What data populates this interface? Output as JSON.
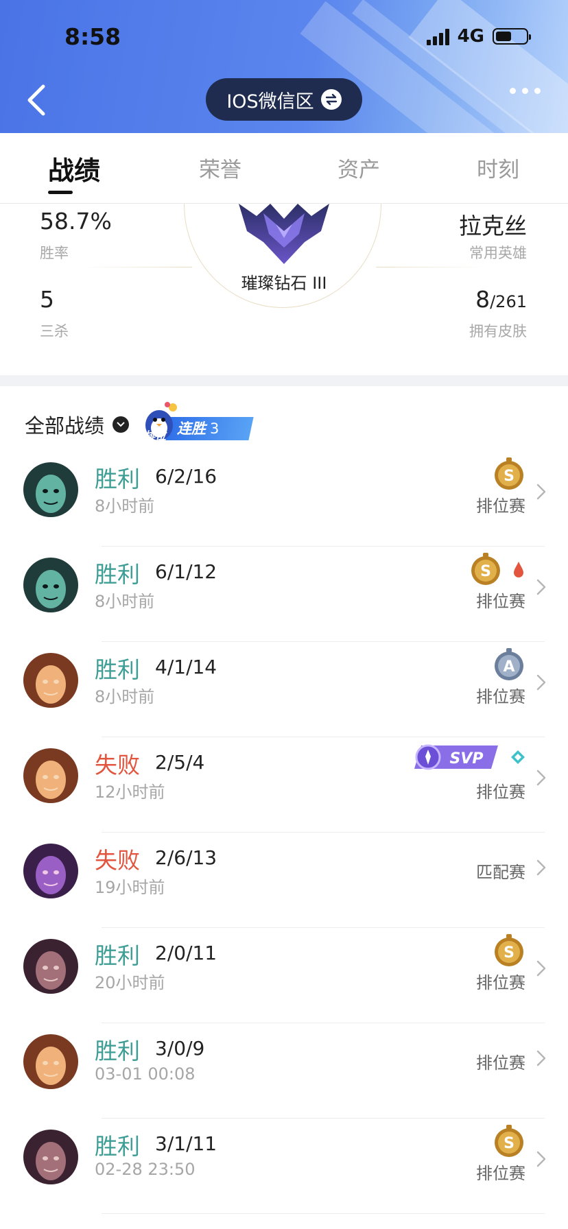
{
  "status_bar": {
    "time": "8:58",
    "network": "4G",
    "battery_level": 0.55
  },
  "header": {
    "server_label": "IOS微信区"
  },
  "tabs": [
    {
      "label": "战绩"
    },
    {
      "label": "荣誉"
    },
    {
      "label": "资产"
    },
    {
      "label": "时刻"
    }
  ],
  "stats": {
    "win_rate": {
      "value": "58.7%",
      "label": "胜率"
    },
    "triple_kills": {
      "value": "5",
      "label": "三杀"
    },
    "rank": "璀璨钻石 III",
    "hero": {
      "value": "拉克丝",
      "label": "常用英雄"
    },
    "skins": {
      "owned": "8",
      "total": "/261",
      "label": "拥有皮肤"
    }
  },
  "filter": {
    "label": "全部战绩",
    "streak_label": "排位",
    "streak_text": "连胜",
    "streak_count": "3"
  },
  "matches": [
    {
      "result": "胜利",
      "kda": "6/2/16",
      "time": "8小时前",
      "mode": "排位赛",
      "grade": "S"
    },
    {
      "result": "胜利",
      "kda": "6/1/12",
      "time": "8小时前",
      "mode": "排位赛",
      "grade": "S"
    },
    {
      "result": "胜利",
      "kda": "4/1/14",
      "time": "8小时前",
      "mode": "排位赛",
      "grade": "A"
    },
    {
      "result": "失败",
      "kda": "2/5/4",
      "time": "12小时前",
      "mode": "排位赛",
      "svp": "SVP"
    },
    {
      "result": "失败",
      "kda": "2/6/13",
      "time": "19小时前",
      "mode": "匹配赛"
    },
    {
      "result": "胜利",
      "kda": "2/0/11",
      "time": "20小时前",
      "mode": "排位赛",
      "grade": "S"
    },
    {
      "result": "胜利",
      "kda": "3/0/9",
      "time": "03-01 00:08",
      "mode": "排位赛"
    },
    {
      "result": "胜利",
      "kda": "3/1/11",
      "time": "02-28 23:50",
      "mode": "排位赛",
      "grade": "S"
    }
  ],
  "colors": {
    "win": "#3e9e95",
    "lose": "#e2563f",
    "header_blue": "#4a74e6",
    "pill_dark": "#1f2c4f"
  }
}
